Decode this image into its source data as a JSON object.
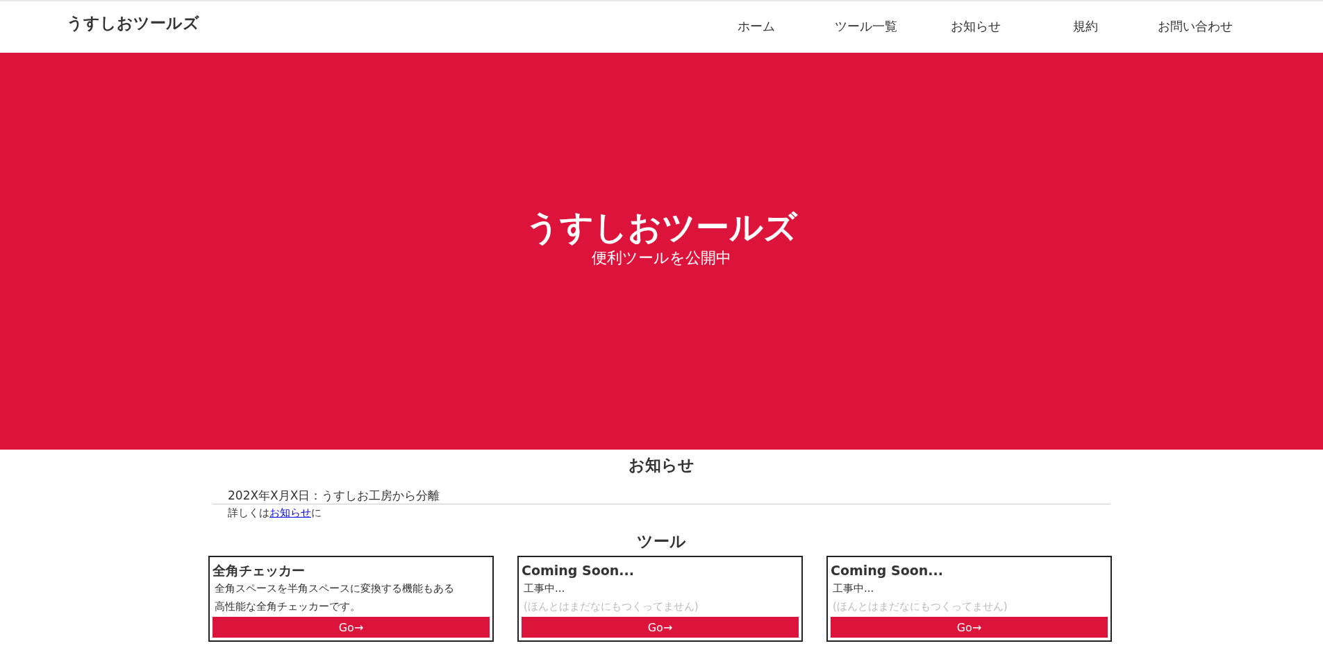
{
  "header": {
    "logo": "うすしおツールズ",
    "nav": [
      "ホーム",
      "ツール一覧",
      "お知らせ",
      "規約",
      "お問い合わせ"
    ]
  },
  "hero": {
    "title": "うすしおツールズ",
    "subtitle": "便利ツールを公開中"
  },
  "notices": {
    "heading": "お知らせ",
    "items": [
      {
        "text": "202X年X月X日：うすしお工房から分離"
      }
    ],
    "detail_before": "詳しくは",
    "detail_link": "お知らせ",
    "detail_after": "に"
  },
  "tools": {
    "heading": "ツール",
    "cards": [
      {
        "title": "全角チェッカー",
        "lines": [
          {
            "text": "全角スペースを半角スペースに変換する機能もある",
            "muted": false
          },
          {
            "text": "高性能な全角チェッカーです。",
            "muted": false
          }
        ],
        "button": "Go→"
      },
      {
        "title": "Coming Soon...",
        "lines": [
          {
            "text": "工事中...",
            "muted": false
          },
          {
            "text": "(ほんとはまだなにもつくってません)",
            "muted": true
          }
        ],
        "button": "Go→"
      },
      {
        "title": "Coming Soon...",
        "lines": [
          {
            "text": "工事中...",
            "muted": false
          },
          {
            "text": "(ほんとはまだなにもつくってません)",
            "muted": true
          }
        ],
        "button": "Go→"
      }
    ]
  }
}
